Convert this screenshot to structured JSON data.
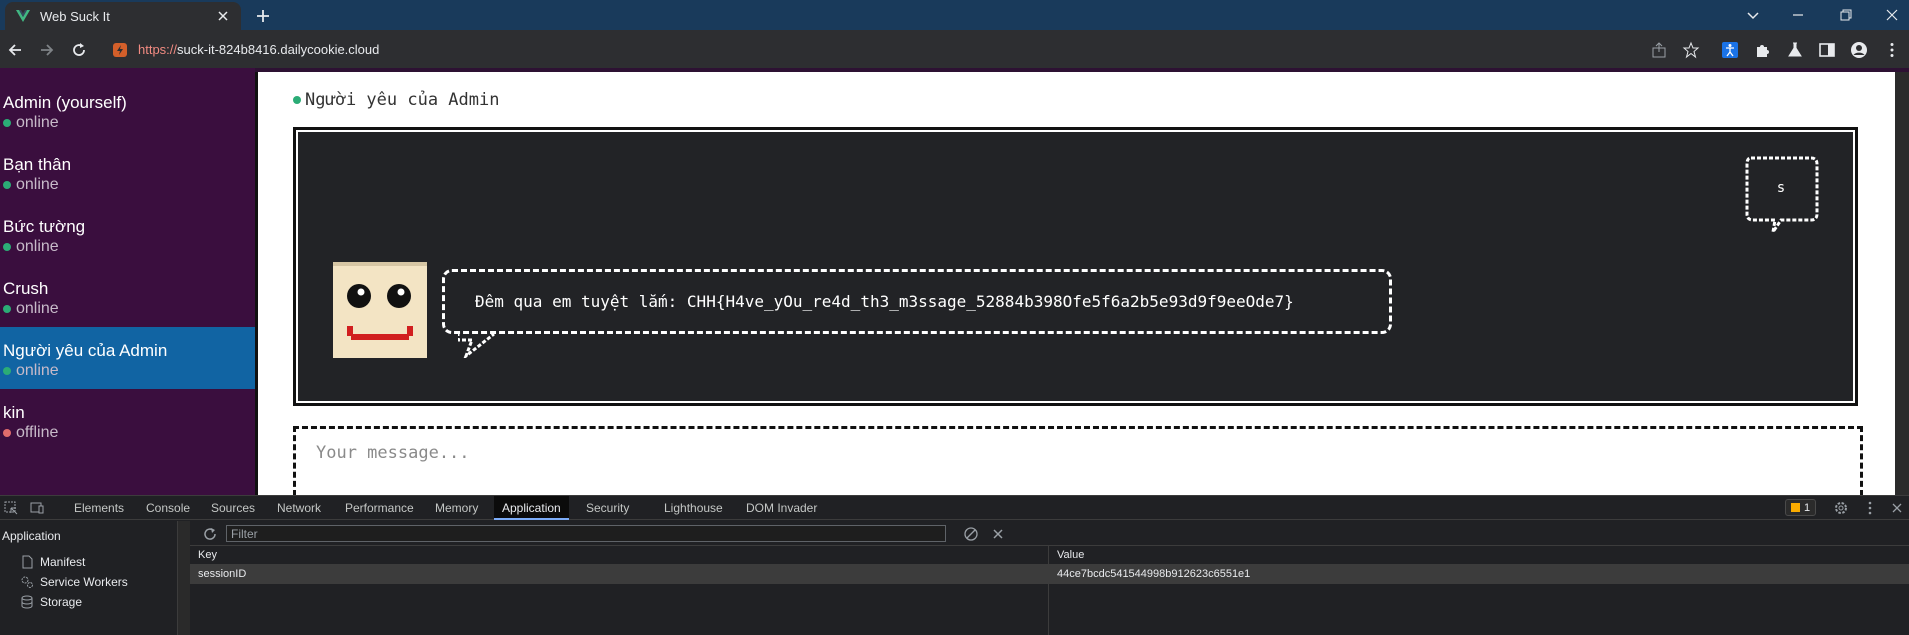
{
  "browser": {
    "tab_title": "Web Suck It",
    "url_scheme": "https://",
    "url_rest": "suck-it-824b8416.dailycookie.cloud"
  },
  "sidebar": {
    "contacts": [
      {
        "name": "Admin (yourself)",
        "status": "online"
      },
      {
        "name": "Bạn thân",
        "status": "online"
      },
      {
        "name": "Bức tường",
        "status": "online"
      },
      {
        "name": "Crush",
        "status": "online"
      },
      {
        "name": "Người yêu của Admin",
        "status": "online"
      },
      {
        "name": "kin",
        "status": "offline"
      }
    ]
  },
  "chat": {
    "title": "Người yêu của Admin",
    "message": "Đêm qua em tuyệt lắm: CHH{H4ve_yOu_re4d_th3_m3ssage_52884b398Ofe5f6a2b5e93d9f9eeOde7}",
    "mini_bubble_text": "s",
    "input_placeholder": "Your message..."
  },
  "devtools": {
    "tabs": [
      "Elements",
      "Console",
      "Sources",
      "Network",
      "Performance",
      "Memory",
      "Application",
      "Security",
      "Lighthouse",
      "DOM Invader"
    ],
    "active_tab": "Application",
    "issues_count": "1",
    "side_header": "Application",
    "side_items": [
      "Manifest",
      "Service Workers",
      "Storage"
    ],
    "filter_placeholder": "Filter",
    "table": {
      "headers": [
        "Key",
        "Value"
      ],
      "rows": [
        {
          "key": "sessionID",
          "value": "44ce7bcdc541544998b912623c6551e1"
        }
      ]
    }
  },
  "colors": {
    "online": "#2bac76",
    "offline": "#e06c6c",
    "sidebar_bg": "#3a0e3e",
    "active_contact": "#1164a3",
    "screen_bg": "#222326"
  }
}
